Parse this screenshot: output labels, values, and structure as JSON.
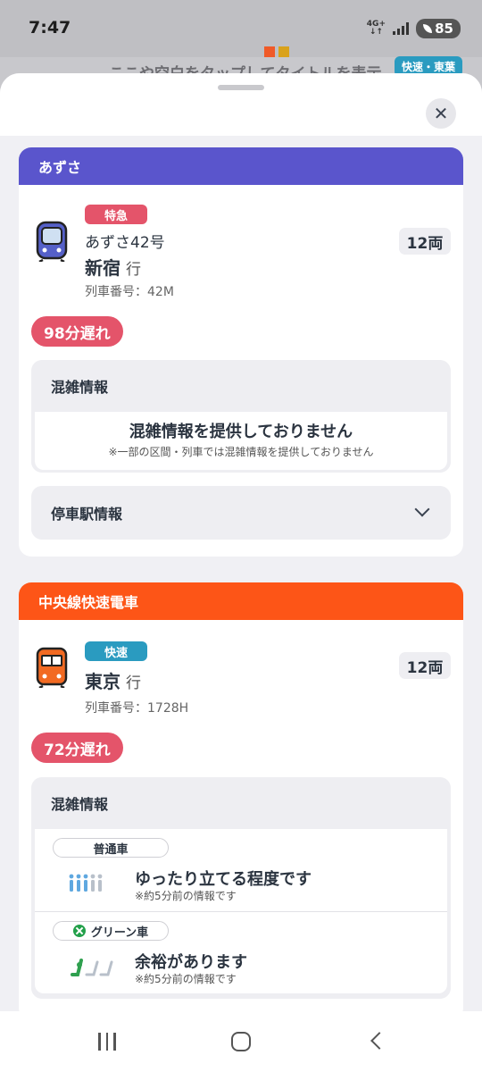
{
  "status_bar": {
    "time": "7:47",
    "network": "4G+",
    "battery": "85"
  },
  "background": {
    "title": "ここや空白をタップしてタイトルを表示",
    "badge": "快速・東葉"
  },
  "trains": [
    {
      "line": "あずさ",
      "line_color": "#5a55cc",
      "icon": "limited-express-train-icon",
      "type": "特急",
      "type_color": "#e4546a",
      "name": "あずさ42号",
      "destination": "新宿",
      "dest_suffix": "行",
      "train_number": "列車番号：42M",
      "cars": "12両",
      "delay": "98分遅れ",
      "crowding": {
        "title": "混雑情報",
        "main": "混雑情報を提供しておりません",
        "note": "※一部の区間・列車では混雑情報を提供しておりません"
      },
      "stops_label": "停車駅情報"
    },
    {
      "line": "中央線快速電車",
      "line_color": "#fd5517",
      "icon": "rapid-train-icon",
      "type": "快速",
      "type_color": "#2a9bc0",
      "destination": "東京",
      "dest_suffix": "行",
      "train_number": "列車番号：1728H",
      "cars": "12両",
      "delay": "72分遅れ",
      "crowding": {
        "title": "混雑情報",
        "rows": [
          {
            "car": "普通車",
            "icon": "standing-people-icon",
            "status": "ゆったり立てる程度です",
            "updated": "※約5分前の情報です"
          },
          {
            "car": "グリーン車",
            "icon": "green-seat-icon",
            "status": "余裕があります",
            "updated": "※約5分前の情報です"
          }
        ]
      }
    }
  ]
}
